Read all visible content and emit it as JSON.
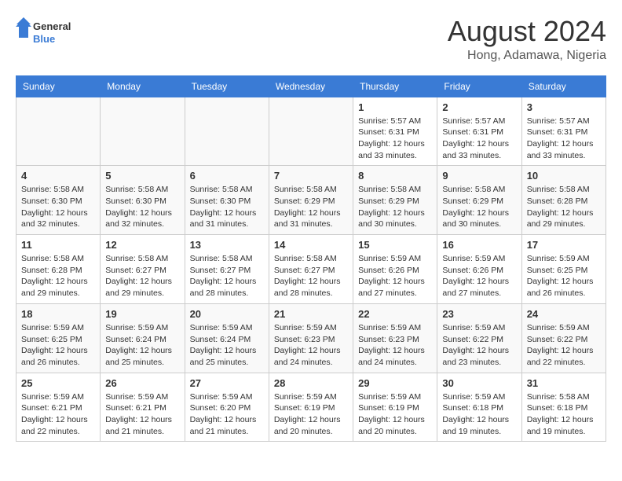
{
  "header": {
    "logo_line1": "General",
    "logo_line2": "Blue",
    "month_year": "August 2024",
    "location": "Hong, Adamawa, Nigeria"
  },
  "days_of_week": [
    "Sunday",
    "Monday",
    "Tuesday",
    "Wednesday",
    "Thursday",
    "Friday",
    "Saturday"
  ],
  "weeks": [
    [
      {
        "day": "",
        "info": ""
      },
      {
        "day": "",
        "info": ""
      },
      {
        "day": "",
        "info": ""
      },
      {
        "day": "",
        "info": ""
      },
      {
        "day": "1",
        "info": "Sunrise: 5:57 AM\nSunset: 6:31 PM\nDaylight: 12 hours\nand 33 minutes."
      },
      {
        "day": "2",
        "info": "Sunrise: 5:57 AM\nSunset: 6:31 PM\nDaylight: 12 hours\nand 33 minutes."
      },
      {
        "day": "3",
        "info": "Sunrise: 5:57 AM\nSunset: 6:31 PM\nDaylight: 12 hours\nand 33 minutes."
      }
    ],
    [
      {
        "day": "4",
        "info": "Sunrise: 5:58 AM\nSunset: 6:30 PM\nDaylight: 12 hours\nand 32 minutes."
      },
      {
        "day": "5",
        "info": "Sunrise: 5:58 AM\nSunset: 6:30 PM\nDaylight: 12 hours\nand 32 minutes."
      },
      {
        "day": "6",
        "info": "Sunrise: 5:58 AM\nSunset: 6:30 PM\nDaylight: 12 hours\nand 31 minutes."
      },
      {
        "day": "7",
        "info": "Sunrise: 5:58 AM\nSunset: 6:29 PM\nDaylight: 12 hours\nand 31 minutes."
      },
      {
        "day": "8",
        "info": "Sunrise: 5:58 AM\nSunset: 6:29 PM\nDaylight: 12 hours\nand 30 minutes."
      },
      {
        "day": "9",
        "info": "Sunrise: 5:58 AM\nSunset: 6:29 PM\nDaylight: 12 hours\nand 30 minutes."
      },
      {
        "day": "10",
        "info": "Sunrise: 5:58 AM\nSunset: 6:28 PM\nDaylight: 12 hours\nand 29 minutes."
      }
    ],
    [
      {
        "day": "11",
        "info": "Sunrise: 5:58 AM\nSunset: 6:28 PM\nDaylight: 12 hours\nand 29 minutes."
      },
      {
        "day": "12",
        "info": "Sunrise: 5:58 AM\nSunset: 6:27 PM\nDaylight: 12 hours\nand 29 minutes."
      },
      {
        "day": "13",
        "info": "Sunrise: 5:58 AM\nSunset: 6:27 PM\nDaylight: 12 hours\nand 28 minutes."
      },
      {
        "day": "14",
        "info": "Sunrise: 5:58 AM\nSunset: 6:27 PM\nDaylight: 12 hours\nand 28 minutes."
      },
      {
        "day": "15",
        "info": "Sunrise: 5:59 AM\nSunset: 6:26 PM\nDaylight: 12 hours\nand 27 minutes."
      },
      {
        "day": "16",
        "info": "Sunrise: 5:59 AM\nSunset: 6:26 PM\nDaylight: 12 hours\nand 27 minutes."
      },
      {
        "day": "17",
        "info": "Sunrise: 5:59 AM\nSunset: 6:25 PM\nDaylight: 12 hours\nand 26 minutes."
      }
    ],
    [
      {
        "day": "18",
        "info": "Sunrise: 5:59 AM\nSunset: 6:25 PM\nDaylight: 12 hours\nand 26 minutes."
      },
      {
        "day": "19",
        "info": "Sunrise: 5:59 AM\nSunset: 6:24 PM\nDaylight: 12 hours\nand 25 minutes."
      },
      {
        "day": "20",
        "info": "Sunrise: 5:59 AM\nSunset: 6:24 PM\nDaylight: 12 hours\nand 25 minutes."
      },
      {
        "day": "21",
        "info": "Sunrise: 5:59 AM\nSunset: 6:23 PM\nDaylight: 12 hours\nand 24 minutes."
      },
      {
        "day": "22",
        "info": "Sunrise: 5:59 AM\nSunset: 6:23 PM\nDaylight: 12 hours\nand 24 minutes."
      },
      {
        "day": "23",
        "info": "Sunrise: 5:59 AM\nSunset: 6:22 PM\nDaylight: 12 hours\nand 23 minutes."
      },
      {
        "day": "24",
        "info": "Sunrise: 5:59 AM\nSunset: 6:22 PM\nDaylight: 12 hours\nand 22 minutes."
      }
    ],
    [
      {
        "day": "25",
        "info": "Sunrise: 5:59 AM\nSunset: 6:21 PM\nDaylight: 12 hours\nand 22 minutes."
      },
      {
        "day": "26",
        "info": "Sunrise: 5:59 AM\nSunset: 6:21 PM\nDaylight: 12 hours\nand 21 minutes."
      },
      {
        "day": "27",
        "info": "Sunrise: 5:59 AM\nSunset: 6:20 PM\nDaylight: 12 hours\nand 21 minutes."
      },
      {
        "day": "28",
        "info": "Sunrise: 5:59 AM\nSunset: 6:19 PM\nDaylight: 12 hours\nand 20 minutes."
      },
      {
        "day": "29",
        "info": "Sunrise: 5:59 AM\nSunset: 6:19 PM\nDaylight: 12 hours\nand 20 minutes."
      },
      {
        "day": "30",
        "info": "Sunrise: 5:59 AM\nSunset: 6:18 PM\nDaylight: 12 hours\nand 19 minutes."
      },
      {
        "day": "31",
        "info": "Sunrise: 5:58 AM\nSunset: 6:18 PM\nDaylight: 12 hours\nand 19 minutes."
      }
    ]
  ]
}
